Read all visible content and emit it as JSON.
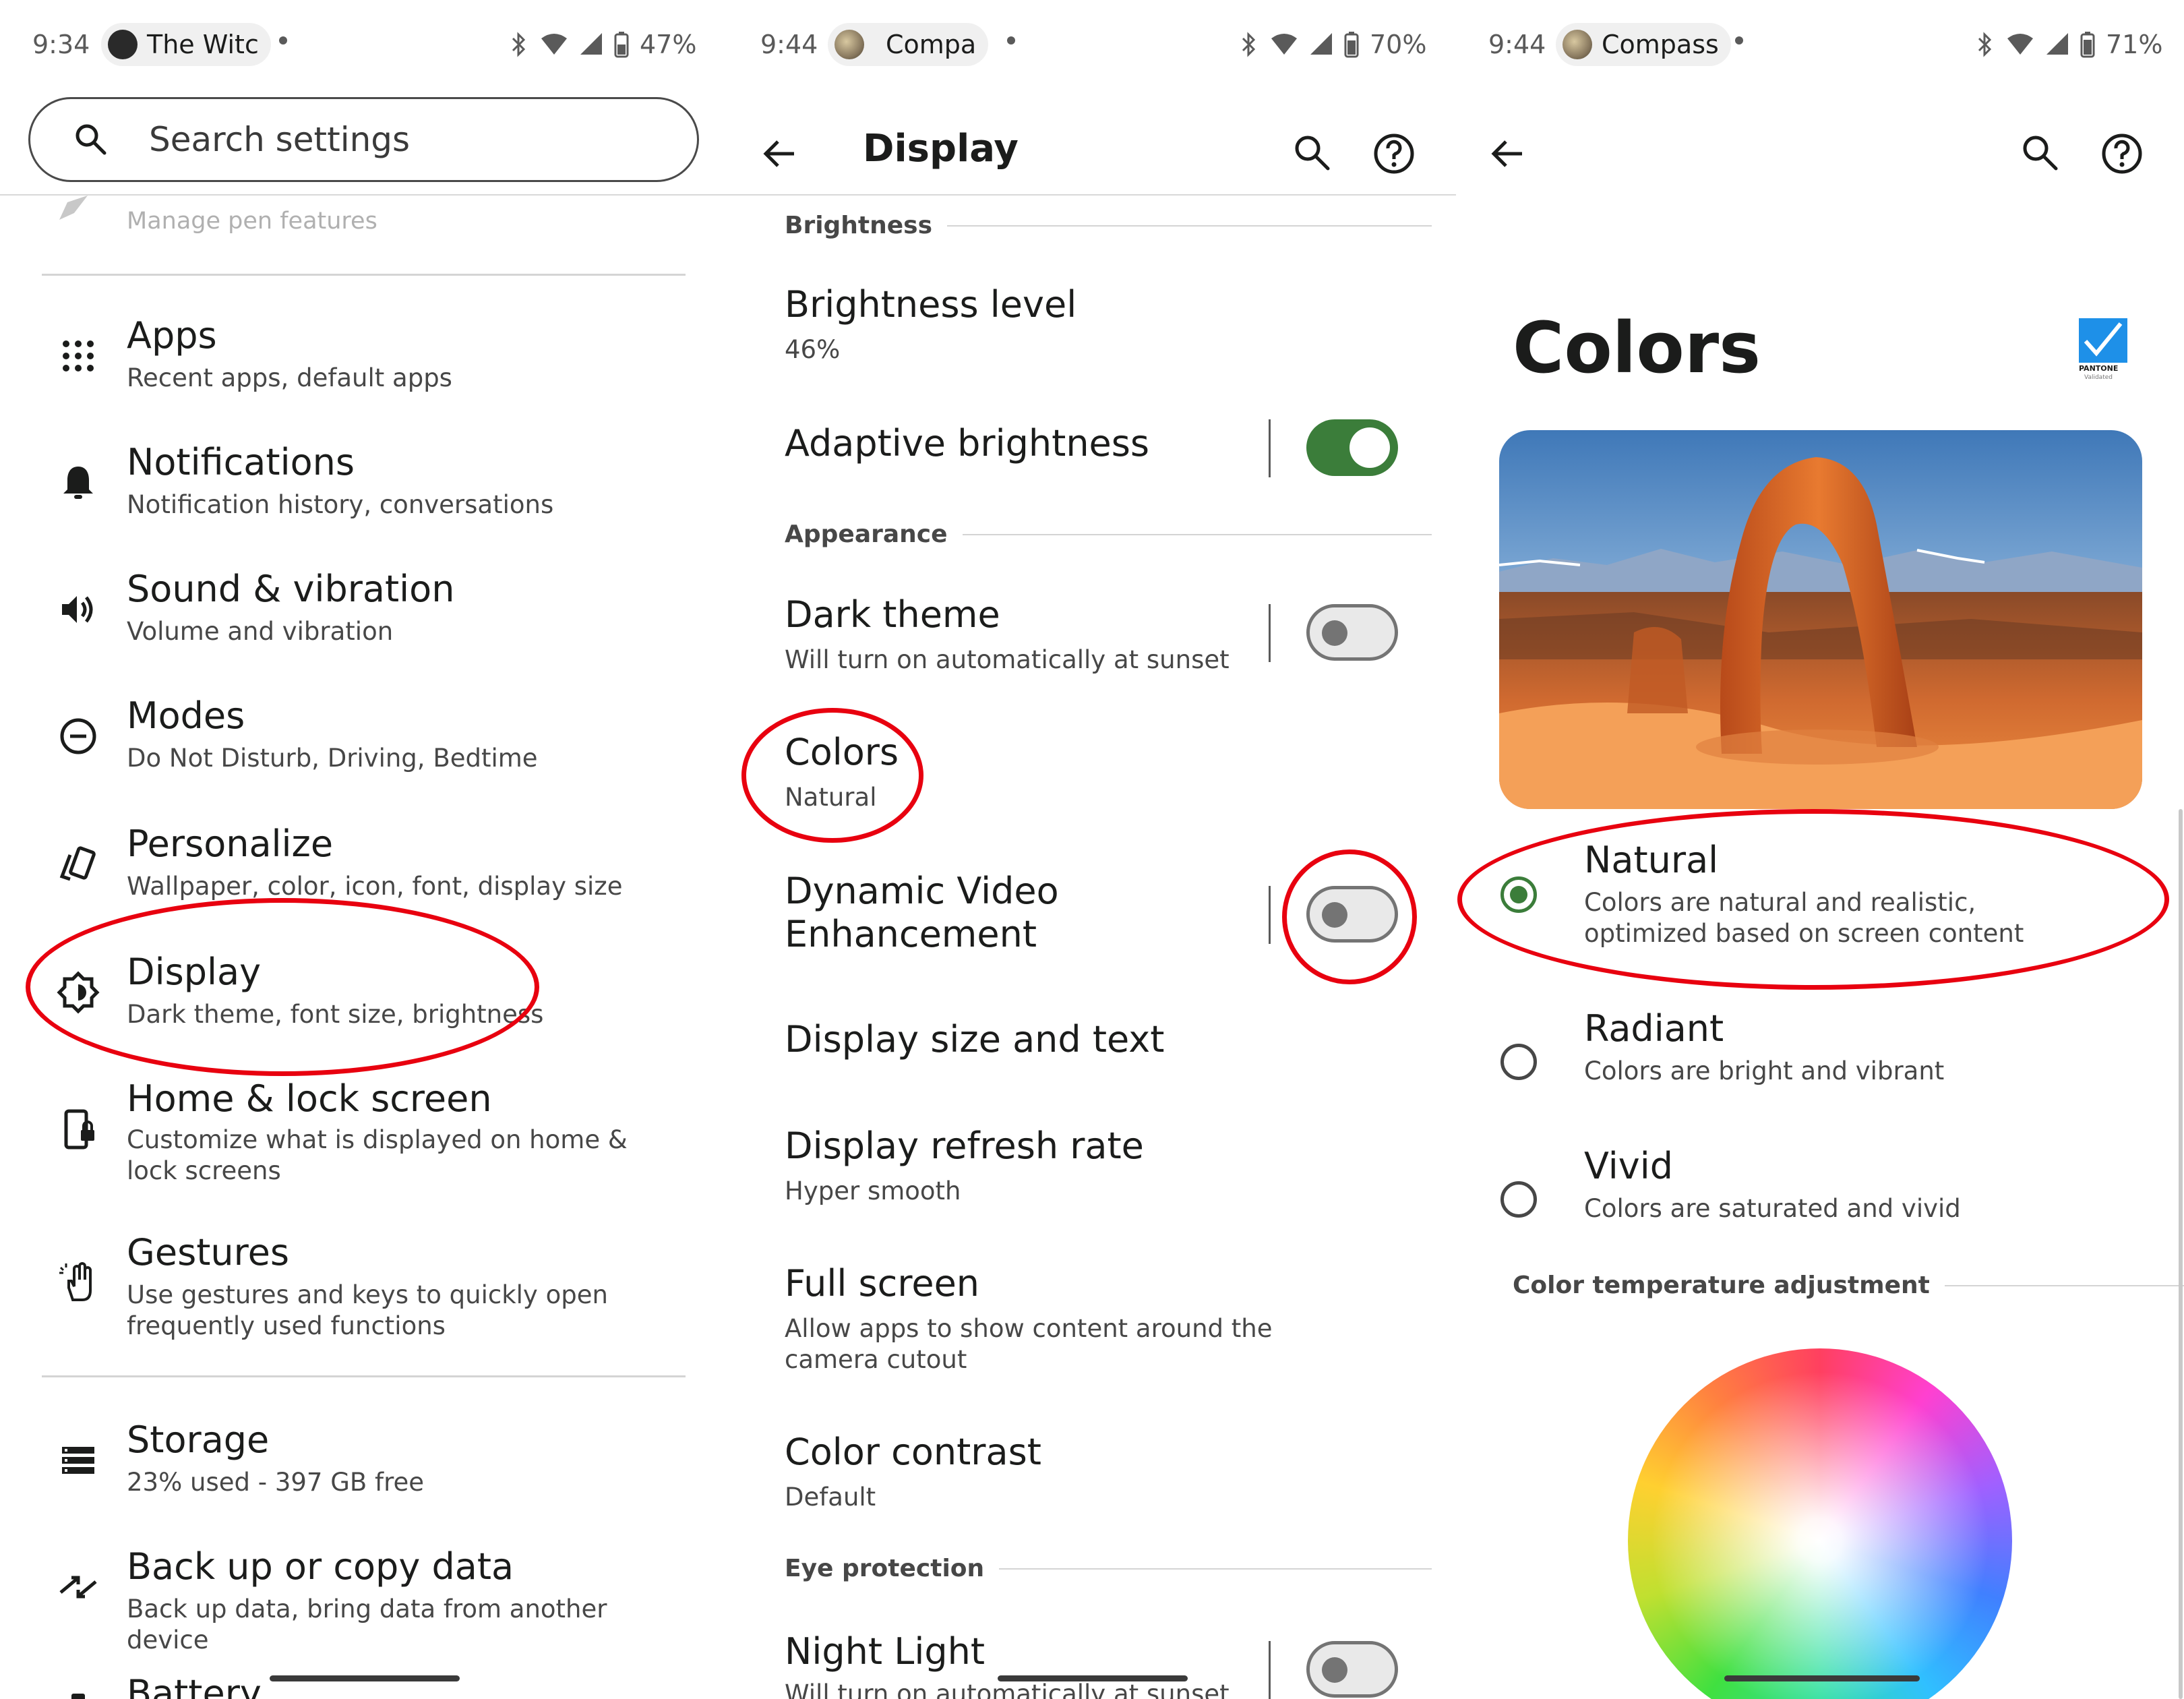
{
  "colors": {
    "accent": "#3b7d3a",
    "annotation_red": "#e8000f",
    "text_primary": "#1b1c1b",
    "text_secondary": "#474747"
  },
  "panel1": {
    "status": {
      "time": "9:34",
      "app": "The Witc",
      "battery": "47%"
    },
    "search_placeholder": "Search settings",
    "faded_item": "Manage pen features",
    "items": [
      {
        "title": "Apps",
        "subtitle": "Recent apps, default apps",
        "icon": "apps-grid-icon"
      },
      {
        "title": "Notifications",
        "subtitle": "Notification history, conversations",
        "icon": "bell-icon"
      },
      {
        "title": "Sound & vibration",
        "subtitle": "Volume and vibration",
        "icon": "speaker-icon"
      },
      {
        "title": "Modes",
        "subtitle": "Do Not Disturb, Driving, Bedtime",
        "icon": "minus-circle-icon"
      },
      {
        "title": "Personalize",
        "subtitle": "Wallpaper, color, icon, font, display size",
        "icon": "cards-icon"
      },
      {
        "title": "Display",
        "subtitle": "Dark theme, font size, brightness",
        "icon": "brightness-icon"
      },
      {
        "title": "Home & lock screen",
        "subtitle": "Customize what is displayed on home & lock screens",
        "icon": "phone-lock-icon"
      },
      {
        "title": "Gestures",
        "subtitle": "Use gestures and keys to quickly open frequently used functions",
        "icon": "hand-icon"
      },
      {
        "title": "Storage",
        "subtitle": "23% used - 397 GB free",
        "icon": "storage-icon"
      },
      {
        "title": "Back up or copy data",
        "subtitle": "Back up data, bring data from another device",
        "icon": "arrows-icon"
      },
      {
        "title": "Battery",
        "subtitle": "",
        "icon": "battery-icon"
      }
    ]
  },
  "panel2": {
    "status": {
      "time": "9:44",
      "app": "Compa",
      "battery": "70%"
    },
    "title": "Display",
    "sections": {
      "brightness": "Brightness",
      "appearance": "Appearance",
      "eye": "Eye protection"
    },
    "rows": {
      "brightness_level": {
        "title": "Brightness level",
        "subtitle": "46%"
      },
      "adaptive": {
        "title": "Adaptive brightness",
        "state": "on"
      },
      "dark_theme": {
        "title": "Dark theme",
        "subtitle": "Will turn on automatically at sunset",
        "state": "off"
      },
      "colors": {
        "title": "Colors",
        "subtitle": "Natural"
      },
      "dve": {
        "title": "Dynamic Video Enhancement",
        "state": "off"
      },
      "size_text": {
        "title": "Display size and text"
      },
      "refresh": {
        "title": "Display refresh rate",
        "subtitle": "Hyper smooth"
      },
      "fullscreen": {
        "title": "Full screen",
        "subtitle": "Allow apps to show content around the camera cutout"
      },
      "contrast": {
        "title": "Color contrast",
        "subtitle": "Default"
      },
      "night": {
        "title": "Night Light",
        "subtitle": "Will turn on automatically at sunset",
        "state": "off"
      }
    }
  },
  "panel3": {
    "status": {
      "time": "9:44",
      "app": "Compass",
      "battery": "71%"
    },
    "title": "Colors",
    "badge": "PANTONE",
    "badge_sub": "Validated",
    "options": [
      {
        "title": "Natural",
        "subtitle": "Colors are natural and realistic, optimized based on screen content",
        "selected": true
      },
      {
        "title": "Radiant",
        "subtitle": "Colors are bright and vibrant",
        "selected": false
      },
      {
        "title": "Vivid",
        "subtitle": "Colors are saturated and vivid",
        "selected": false
      }
    ],
    "section_temp": "Color temperature adjustment"
  }
}
